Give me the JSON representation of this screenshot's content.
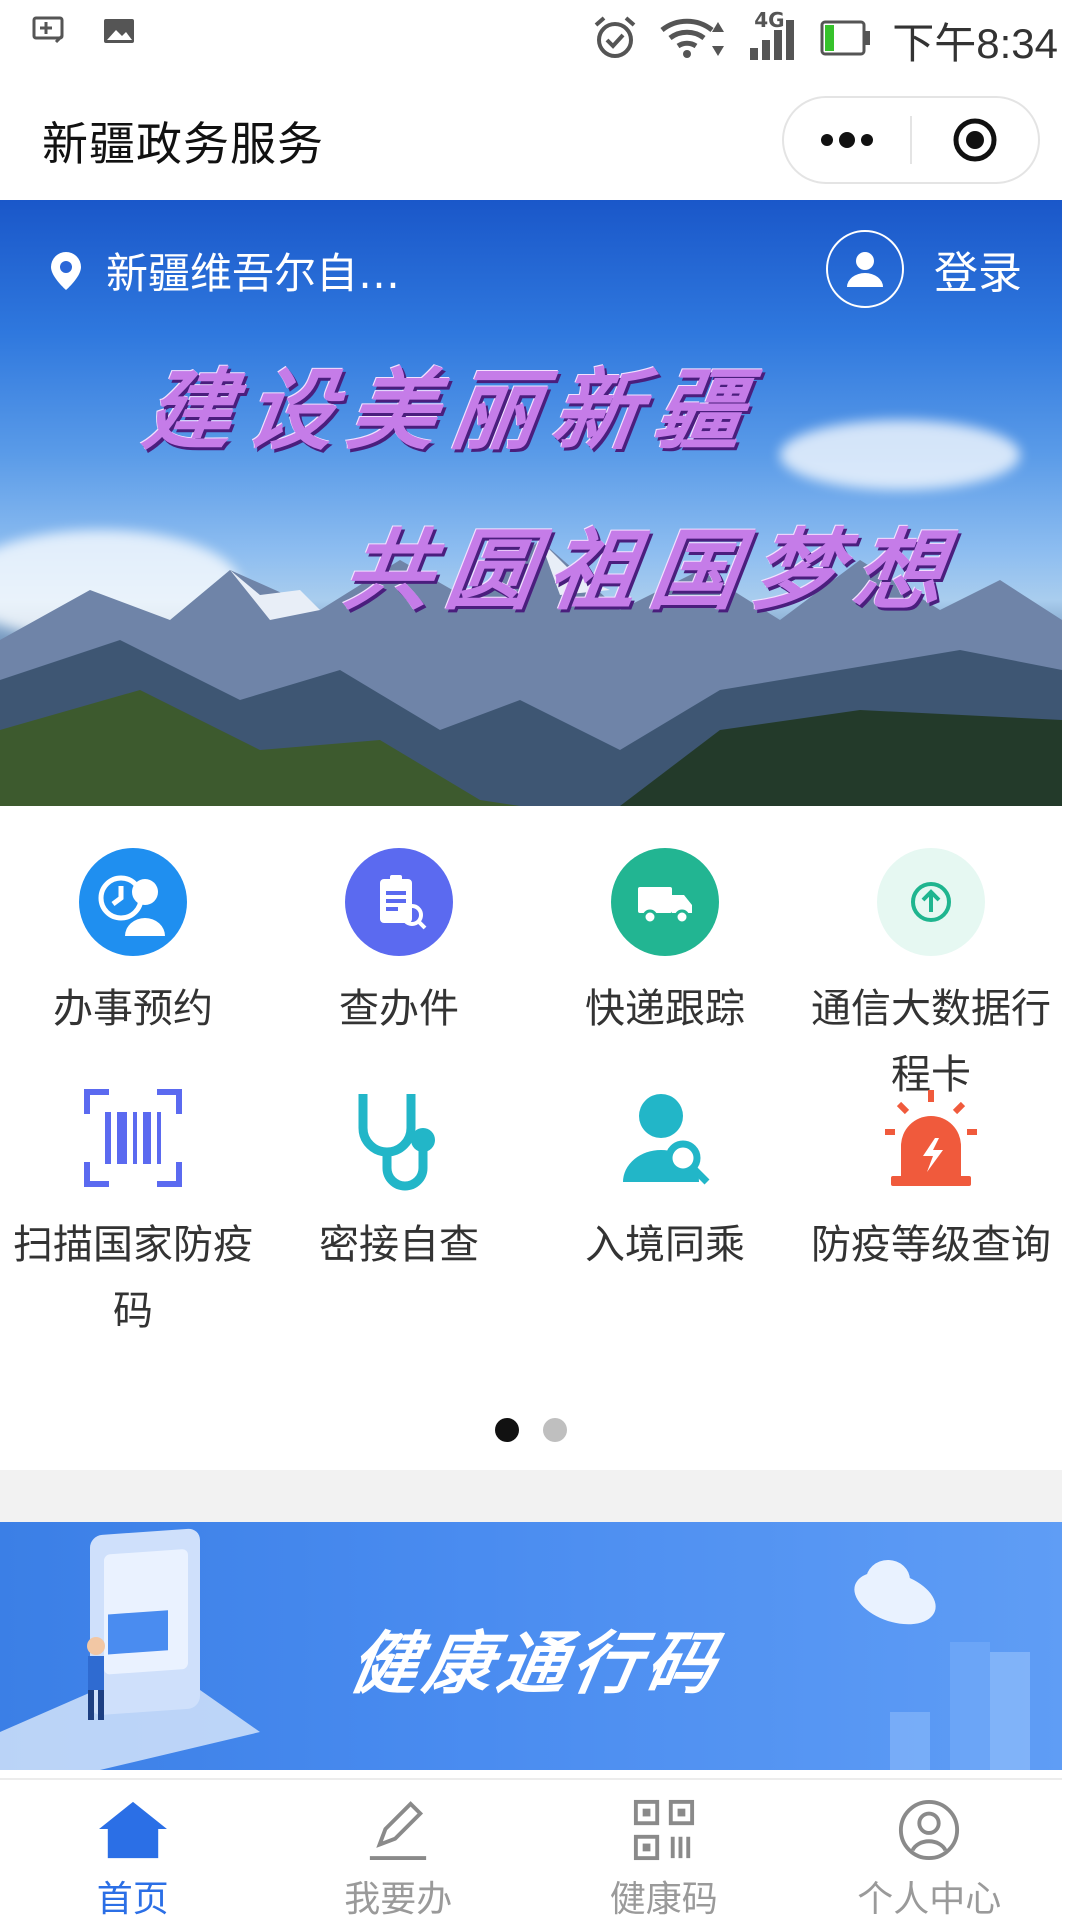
{
  "status_bar": {
    "network": "4G",
    "time": "下午8:34"
  },
  "header": {
    "title": "新疆政务服务"
  },
  "hero": {
    "location": "新疆维吾尔自…",
    "login_label": "登录",
    "slogan_line1": "建设美丽新疆",
    "slogan_line2": "共圆祖国梦想"
  },
  "services": [
    {
      "label": "办事预约",
      "icon": "clock-person-icon",
      "color": "#1f8ff0"
    },
    {
      "label": "查办件",
      "icon": "clipboard-search-icon",
      "color": "#5b6af0"
    },
    {
      "label": "快递跟踪",
      "icon": "truck-icon",
      "color": "#22b592"
    },
    {
      "label": "通信大数据行程卡",
      "icon": "arrow-up-circle-icon",
      "color": "#1fb58f"
    },
    {
      "label": "扫描国家防疫码",
      "icon": "barcode-scan-icon",
      "color": "#5b6af0"
    },
    {
      "label": "密接自查",
      "icon": "stethoscope-icon",
      "color": "#22b6c8"
    },
    {
      "label": "入境同乘",
      "icon": "person-search-icon",
      "color": "#22b6c8"
    },
    {
      "label": "防疫等级查询",
      "icon": "alarm-light-icon",
      "color": "#f05a3c"
    }
  ],
  "pager": {
    "pages": 2,
    "active": 1
  },
  "health_banner": {
    "title": "健康通行码"
  },
  "tabs": [
    {
      "label": "首页",
      "icon": "home-icon",
      "active": true
    },
    {
      "label": "我要办",
      "icon": "pen-icon",
      "active": false
    },
    {
      "label": "健康码",
      "icon": "qr-code-icon",
      "active": false
    },
    {
      "label": "个人中心",
      "icon": "user-icon",
      "active": false
    }
  ],
  "colors": {
    "accent": "#2b6fe6",
    "tab_inactive": "#9a9a9a"
  }
}
